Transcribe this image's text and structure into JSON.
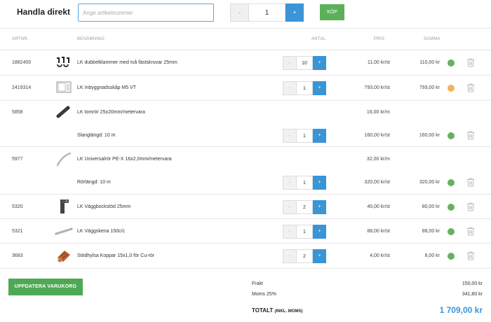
{
  "quick_buy": {
    "title": "Handla direkt",
    "placeholder": "Ange artikelnummer",
    "minus": "-",
    "quantity": "1",
    "plus": "+",
    "buy_label": "KÖP"
  },
  "table": {
    "headers": {
      "artnr": "ARTNR.",
      "benamning": "BENÄMNING",
      "antal": "ANTAL",
      "pris": "PRIS",
      "summa": "SUMMA"
    },
    "rows": [
      {
        "artnr": "1882400",
        "name": "LK dubbelklammer med två fästskruvar 25mm",
        "qty": "10",
        "price": "11,00 kr/st",
        "sum": "110,00 kr",
        "status": "green",
        "image": "clamp-icon"
      },
      {
        "artnr": "2419314",
        "name": "LK Inbyggnadsskåp M5 VT",
        "qty": "1",
        "price": "793,00 kr/st",
        "sum": "793,00 kr",
        "status": "orange",
        "image": "cabinet-icon"
      },
      {
        "artnr": "5858",
        "name": "LK tomrör 25x20mm/metervara",
        "price": "16,00 kr/m",
        "image": "conduit-icon"
      },
      {
        "name": "Slanglängd: 10 m",
        "qty": "1",
        "price": "160,00 kr/st",
        "sum": "160,00 kr",
        "status": "green"
      },
      {
        "artnr": "5977",
        "name": "LK Universalrör PE-X 16x2,0mm/metervara",
        "price": "32,00 kr/m",
        "image": "pipe-icon"
      },
      {
        "name": "Rörlängd: 10 m",
        "qty": "1",
        "price": "320,00 kr/st",
        "sum": "320,00 kr",
        "status": "green"
      },
      {
        "artnr": "5320",
        "name": "LK Väggbockstöd 25mm",
        "qty": "2",
        "price": "40,00 kr/st",
        "sum": "80,00 kr",
        "status": "green",
        "image": "bracket-icon"
      },
      {
        "artnr": "5321",
        "name": "LK Väggskena 150c/c",
        "qty": "1",
        "price": "88,00 kr/st",
        "sum": "88,00 kr",
        "status": "green",
        "image": "rail-icon"
      },
      {
        "artnr": "3683",
        "name": "Stödhylsa Koppar 15x1,0 för Cu-rör",
        "qty": "2",
        "price": "4,00 kr/st",
        "sum": "8,00 kr",
        "status": "green",
        "image": "copper-sleeve-icon"
      }
    ]
  },
  "footer": {
    "update_label": "UPPDATERA VARUKORG",
    "frakt_label": "Frakt",
    "frakt_value": "150,00 kr",
    "moms_label": "Moms 25%",
    "moms_value": "341,80 kr",
    "total_label": "TOTALT",
    "total_note": "(INKL. MOMS)",
    "total_value": "1 709,00 kr"
  },
  "colors": {
    "accent": "#3a95d6",
    "buy": "#5cb05a",
    "status_green": "#64b35d",
    "status_orange": "#f2b35b"
  }
}
